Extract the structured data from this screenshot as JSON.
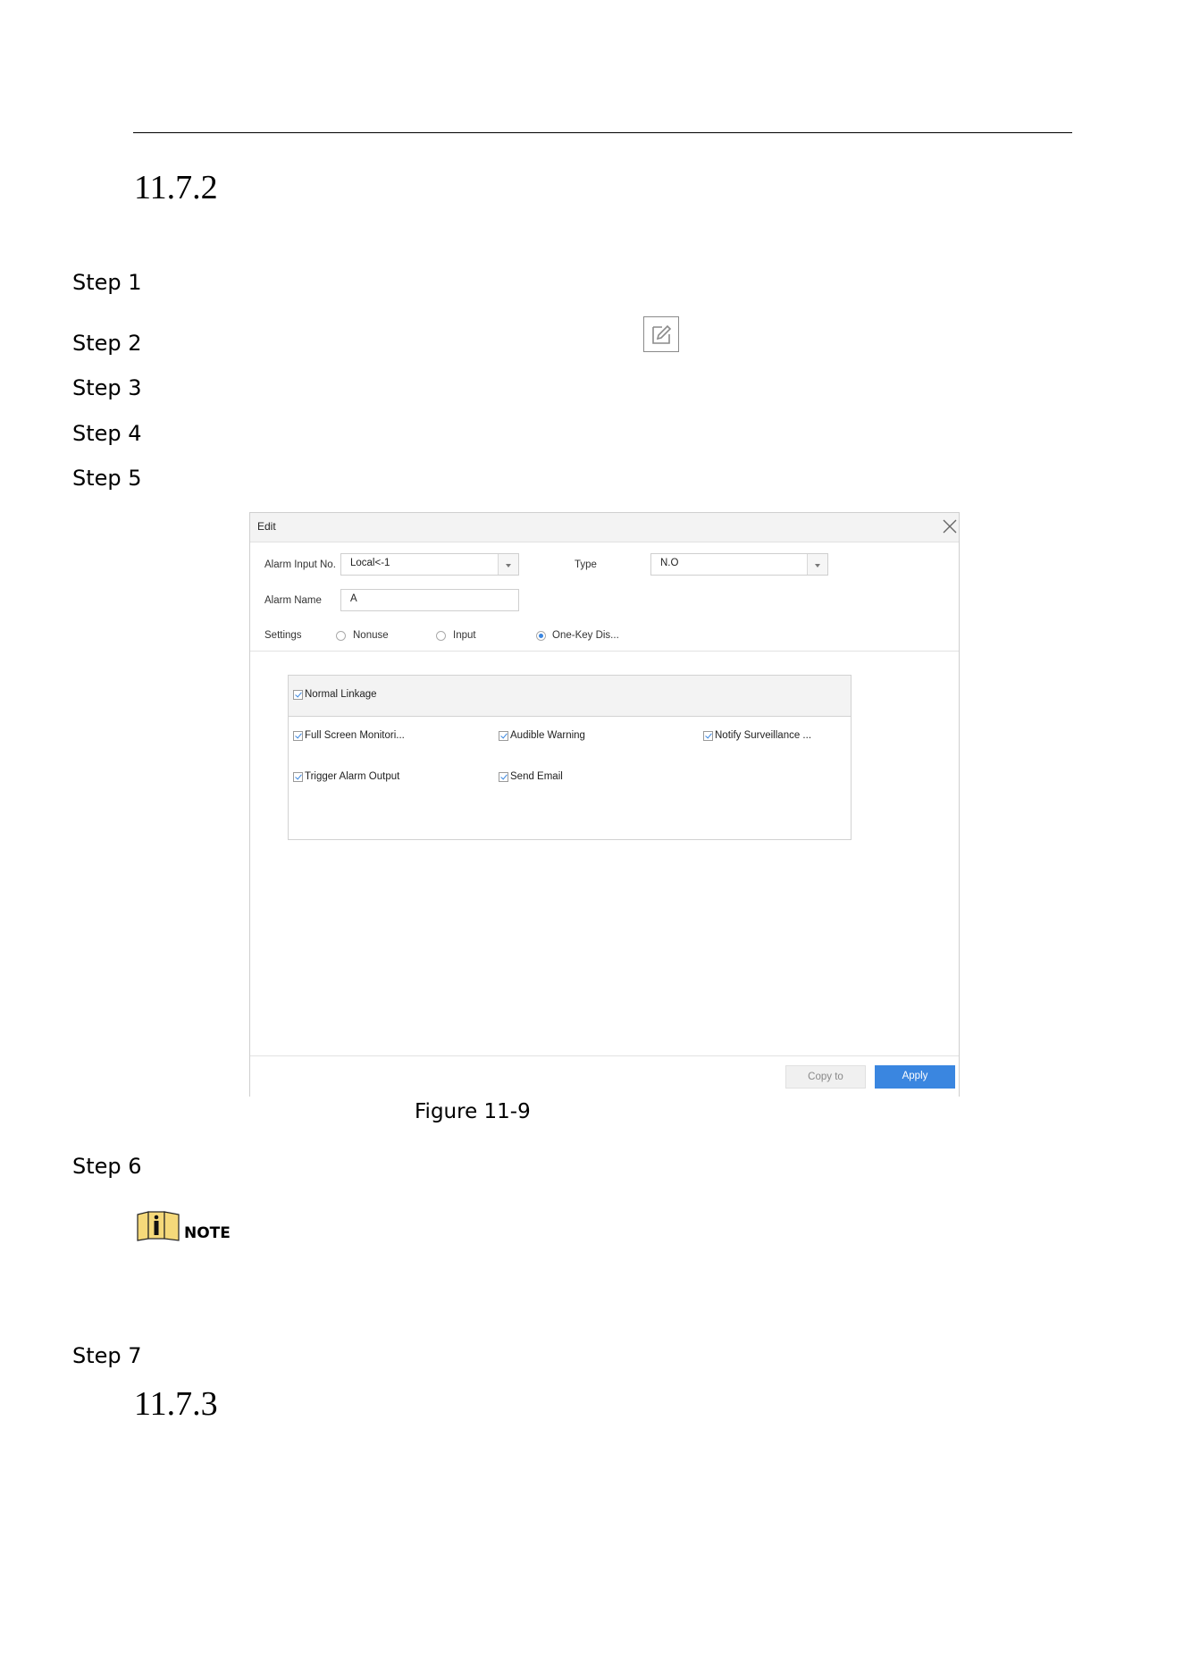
{
  "section_a": {
    "number": "11.7.2"
  },
  "steps": [
    "Step 1",
    "Step 2",
    "Step 3",
    "Step 4",
    "Step 5",
    "Step 6",
    "Step 7"
  ],
  "edit_icon": "edit-icon",
  "dialog": {
    "title": "Edit",
    "alarm_input_label": "Alarm Input No.",
    "alarm_input_value": "Local<-1",
    "type_label": "Type",
    "type_value": "N.O",
    "alarm_name_label": "Alarm Name",
    "alarm_name_value": "A",
    "settings_label": "Settings",
    "settings_options": [
      "Nonuse",
      "Input",
      "One-Key Dis..."
    ],
    "settings_selected": "One-Key Dis...",
    "linkage_title": "Normal Linkage",
    "linkage_items": [
      "Full Screen Monitori...",
      "Audible Warning",
      "Notify Surveillance ...",
      "Trigger Alarm Output",
      "Send Email"
    ],
    "copy_label": "Copy to",
    "apply_label": "Apply"
  },
  "figure_caption": "Figure 11-9",
  "note_label": "NOTE",
  "section_b": {
    "number": "11.7.3"
  },
  "colors": {
    "accent": "#3a86e0",
    "note_icon": "#f5d97a"
  }
}
